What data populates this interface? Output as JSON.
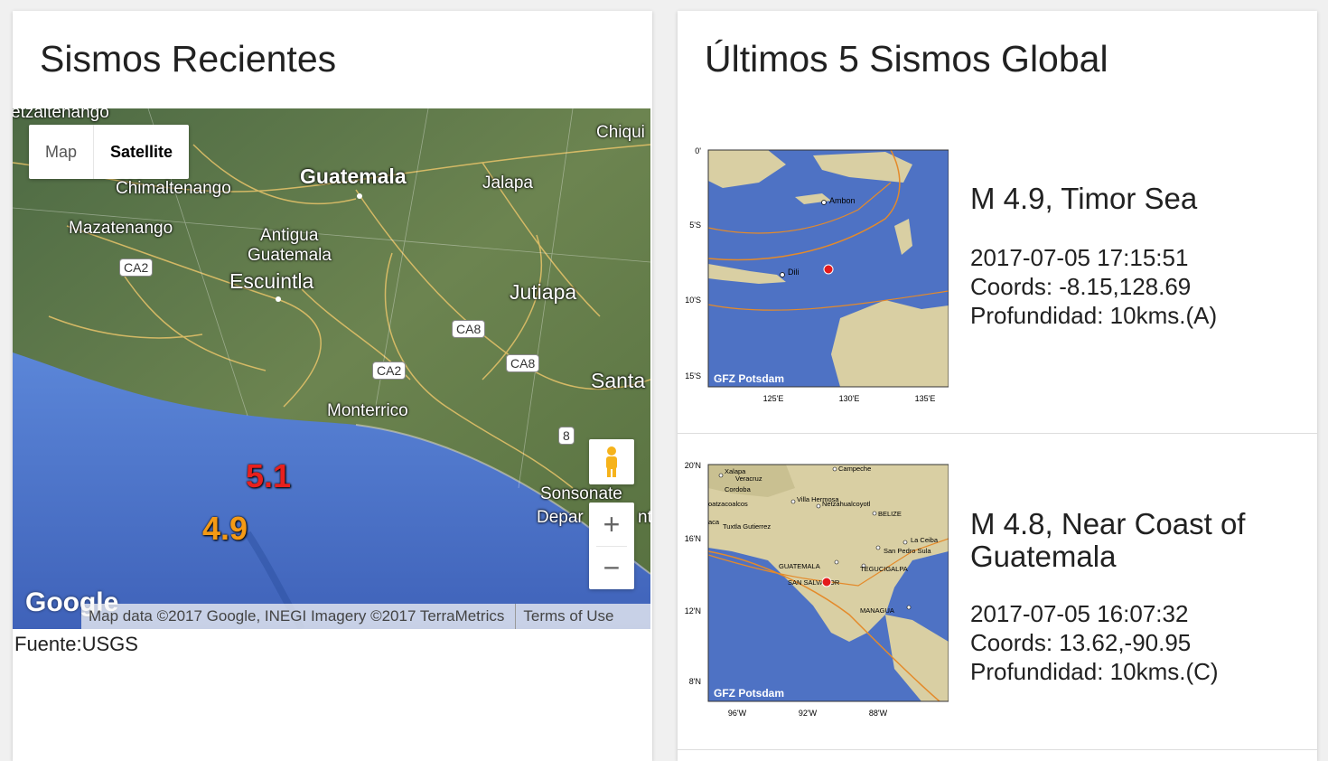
{
  "left": {
    "title": "Sismos Recientes",
    "map_type": {
      "map": "Map",
      "satellite": "Satellite",
      "selected": "Satellite"
    },
    "labels": {
      "quetzaltenango": "etzaltenango",
      "chiquimula": "Chiqui",
      "guatemala": "Guatemala",
      "jalapa": "Jalapa",
      "chimaltenango": "Chimaltenango",
      "mazatenango": "Mazatenango",
      "antigua1": "Antigua",
      "antigua2": "Guatemala",
      "escuintla": "Escuintla",
      "jutiapa": "Jutiapa",
      "santa": "Santa",
      "monterrico": "Monterrico",
      "sonsonate": "Sonsonate",
      "depart": "Depar",
      "depart2": "nt"
    },
    "shields": {
      "ca2a": "CA2",
      "ca2b": "CA2",
      "ca8a": "CA8",
      "ca8b": "CA8",
      "r8": "8"
    },
    "quakes": [
      {
        "mag": "5.1",
        "color": "#e8201d"
      },
      {
        "mag": "4.9",
        "color": "#f59a15"
      }
    ],
    "zoom": {
      "in": "+",
      "out": "−"
    },
    "google": "Google",
    "attribution": "Map data ©2017 Google, INEGI Imagery ©2017 TerraMetrics",
    "terms": "Terms of Use",
    "source": "Fuente:USGS"
  },
  "right": {
    "title": "Últimos 5 Sismos Global",
    "quakes": [
      {
        "title": "M 4.9, Timor Sea",
        "date": "2017-07-05 17:15:51",
        "coords": "Coords: -8.15,128.69",
        "depth": "Profundidad: 10kms.(A)",
        "map": {
          "credit": "GFZ Potsdam",
          "yticks": [
            "0'",
            "5'S",
            "10'S",
            "15'S"
          ],
          "xticks": [
            "125'E",
            "130'E",
            "135'E"
          ],
          "places": [
            "Ambon",
            "Dili"
          ]
        }
      },
      {
        "title": "M 4.8, Near Coast of Guatemala",
        "date": "2017-07-05 16:07:32",
        "coords": "Coords: 13.62,-90.95",
        "depth": "Profundidad: 10kms.(C)",
        "map": {
          "credit": "GFZ Potsdam",
          "yticks": [
            "20'N",
            "16'N",
            "12'N",
            "8'N"
          ],
          "xticks": [
            "96'W",
            "92'W",
            "88'W"
          ],
          "places": [
            "Campeche",
            "Xalapa",
            "Veracruz",
            "Cordoba",
            "oatzacoalcos",
            "Villa Hermosa",
            "Netzahualcoyotl",
            "BELIZE",
            "aca",
            "Tuxtla Gutierrez",
            "La Ceiba",
            "San Pedro Sula",
            "GUATEMALA",
            "TEGUCIGALPA",
            "SAN SALVADOR",
            "MANAGUA"
          ]
        }
      }
    ]
  },
  "colors": {
    "ocean": "#3d64b8",
    "land": "#d9cfa3",
    "plate": "#e48a2a",
    "epicenter": "#e41a1c"
  }
}
